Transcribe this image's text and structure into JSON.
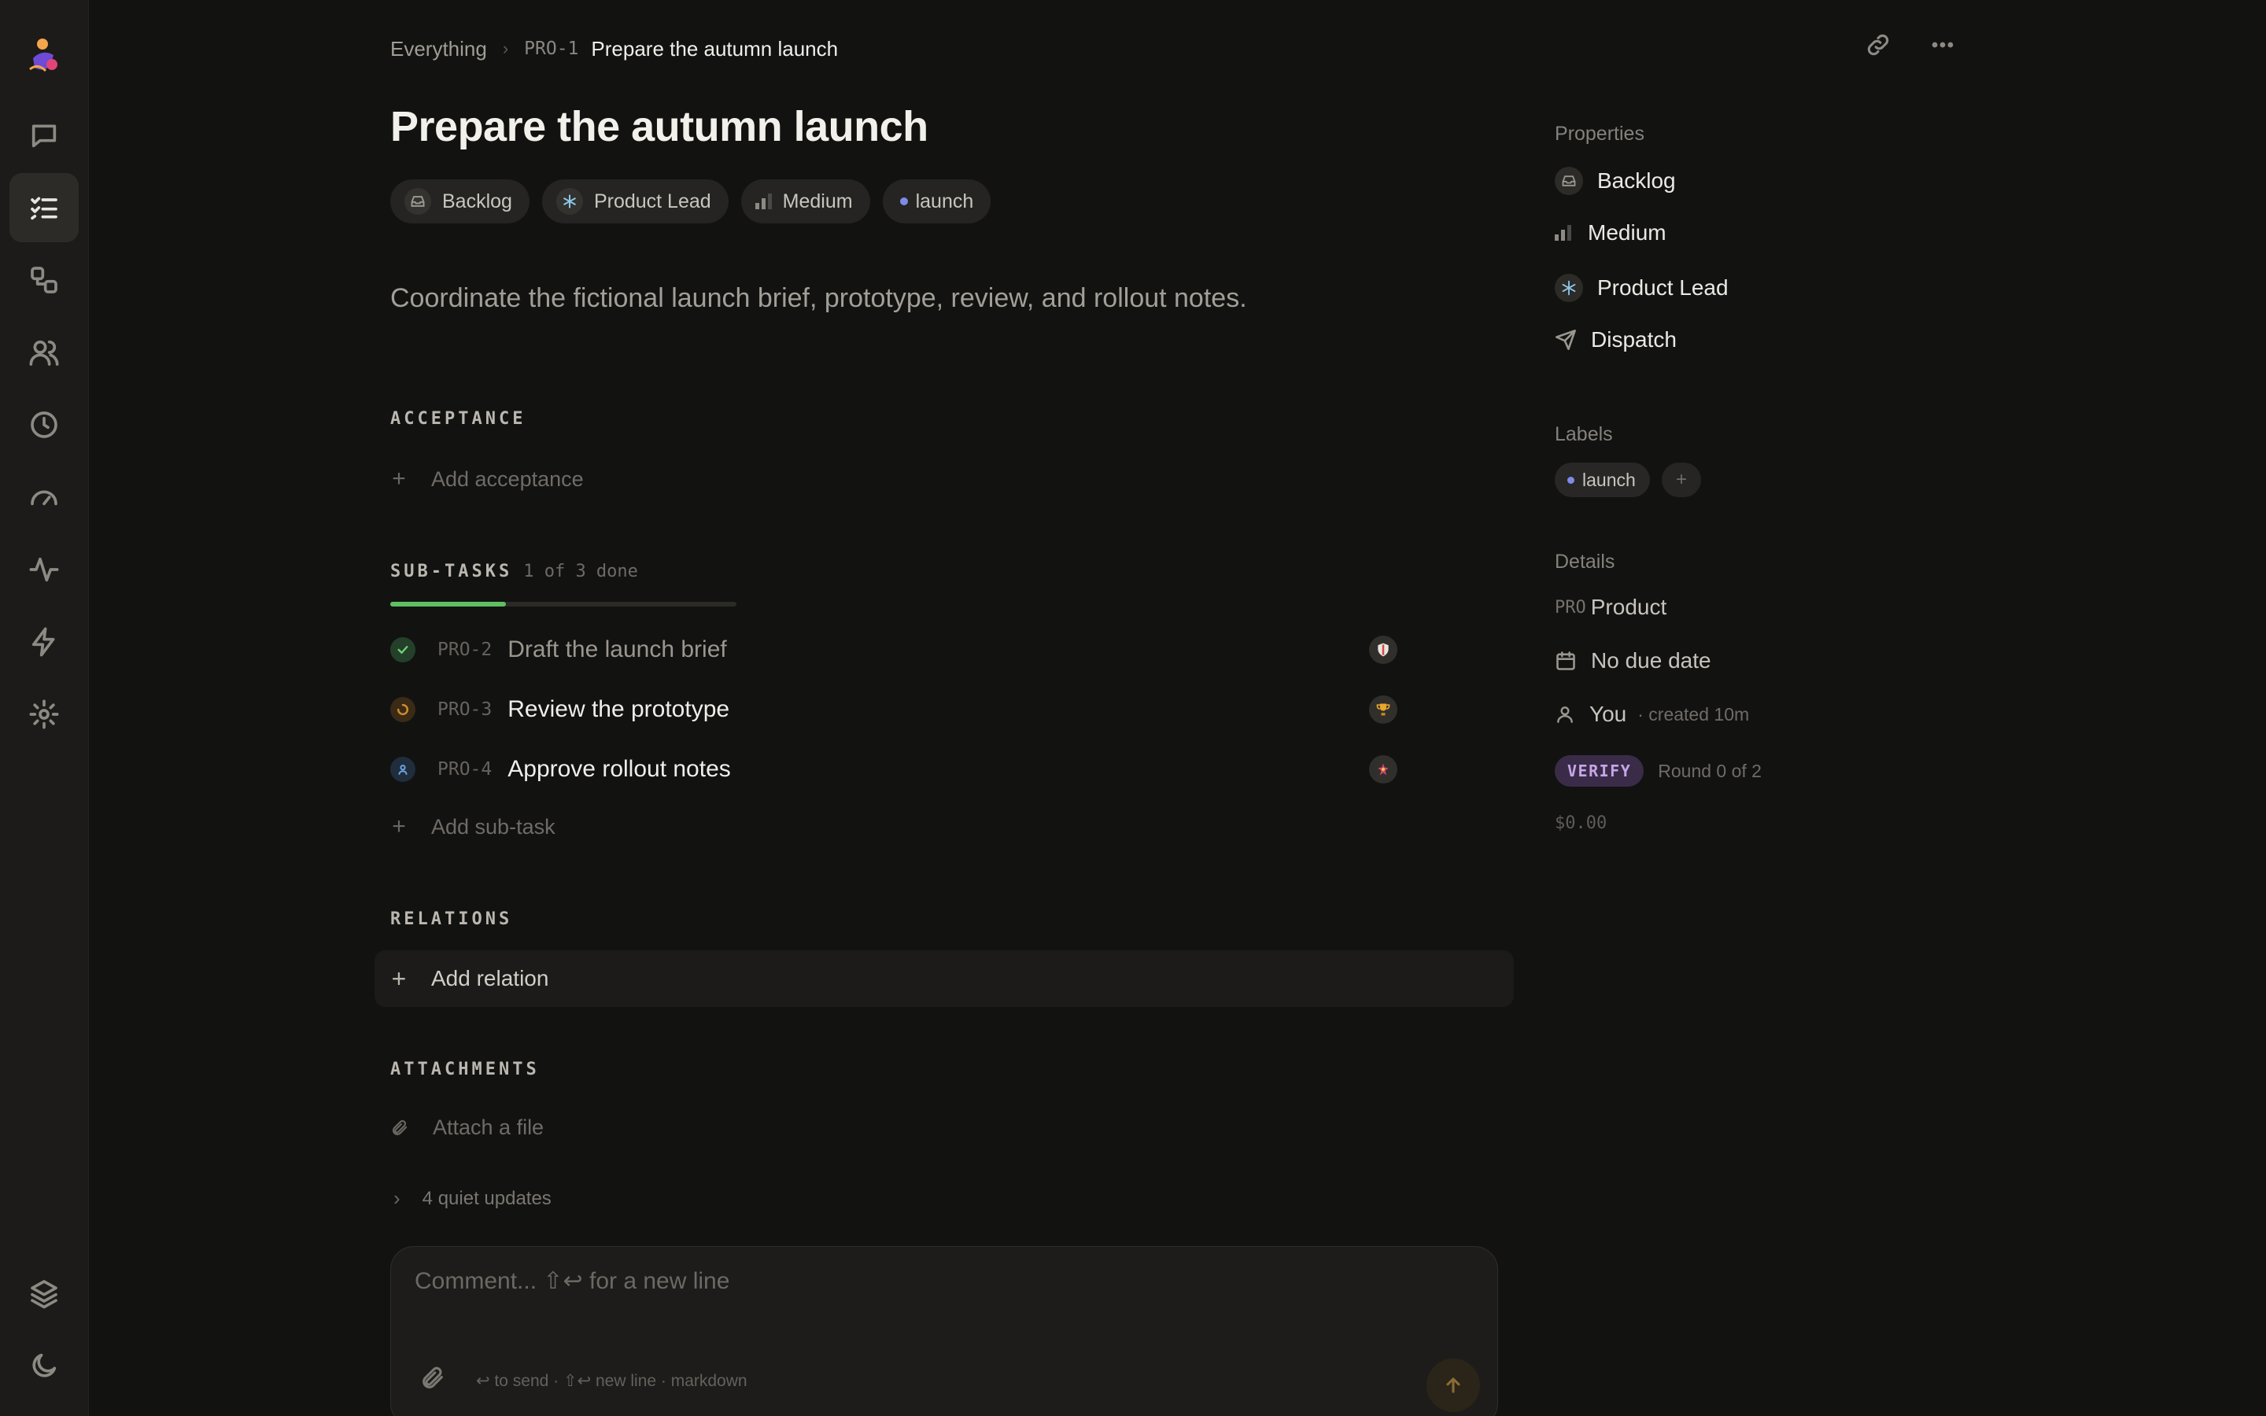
{
  "breadcrumb": {
    "root": "Everything",
    "code": "PRO-1",
    "current": "Prepare the autumn launch"
  },
  "issue": {
    "title": "Prepare the autumn launch",
    "chips": {
      "status": "Backlog",
      "assignee": "Product Lead",
      "priority": "Medium",
      "label": "launch"
    },
    "description": "Coordinate the fictional launch brief, prototype, review, and rollout notes."
  },
  "acceptance": {
    "heading": "ACCEPTANCE",
    "add_label": "Add acceptance"
  },
  "subtasks": {
    "heading": "SUB-TASKS",
    "summary": "1 of 3 done",
    "progress": 0.333,
    "items": [
      {
        "code": "PRO-2",
        "name": "Draft the launch brief",
        "status": "done",
        "avatar": "shield-icon"
      },
      {
        "code": "PRO-3",
        "name": "Review the prototype",
        "status": "in-progress",
        "avatar": "trophy-icon"
      },
      {
        "code": "PRO-4",
        "name": "Approve rollout notes",
        "status": "assigned",
        "avatar": "spark-icon"
      }
    ],
    "add_label": "Add sub-task"
  },
  "relations": {
    "heading": "RELATIONS",
    "add_label": "Add relation"
  },
  "attachments": {
    "heading": "ATTACHMENTS",
    "add_label": "Attach a file"
  },
  "activity": {
    "quiet_updates": "4 quiet updates"
  },
  "composer": {
    "placeholder": "Comment...  ⇧↩ for a new line",
    "hint": "↩ to send · ⇧↩ new line · markdown"
  },
  "properties": {
    "heading": "Properties",
    "status": "Backlog",
    "priority": "Medium",
    "assignee": "Product Lead",
    "dispatch": "Dispatch"
  },
  "labels": {
    "heading": "Labels",
    "items": [
      "launch"
    ],
    "add": "+"
  },
  "details": {
    "heading": "Details",
    "project_code": "PRO",
    "project": "Product",
    "due": "No due date",
    "creator": "You",
    "created": "· created 10m",
    "verify_badge": "VERIFY",
    "round": "Round 0 of 2",
    "cost": "$0.00"
  },
  "colors": {
    "accent_progress": "#5fbf63",
    "label_dot": "#7d8be8",
    "verify_bg": "#3a2c48",
    "verify_fg": "#c6a6e8",
    "in_progress": "#d08a2c"
  }
}
